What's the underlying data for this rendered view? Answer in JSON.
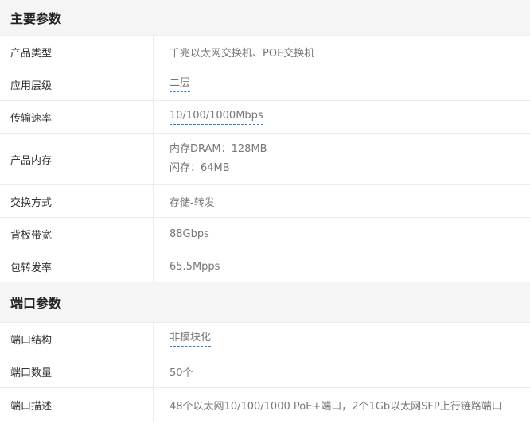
{
  "sections": [
    {
      "title": "主要参数",
      "rows": [
        {
          "label": "产品类型",
          "value": "千兆以太网交换机、POE交换机"
        },
        {
          "label": "应用层级",
          "value": "二层"
        },
        {
          "label": "传输速率",
          "value": "10/100/1000Mbps"
        },
        {
          "label": "产品内存",
          "lines": [
            "内存DRAM：128MB",
            "闪存：64MB"
          ]
        },
        {
          "label": "交换方式",
          "value": "存储-转发"
        },
        {
          "label": "背板带宽",
          "value": "88Gbps"
        },
        {
          "label": "包转发率",
          "value": "65.5Mpps"
        }
      ]
    },
    {
      "title": "端口参数",
      "rows": [
        {
          "label": "端口结构",
          "value": "非模块化"
        },
        {
          "label": "端口数量",
          "value": "50个"
        },
        {
          "label": "端口描述",
          "value": "48个以太网10/100/1000 PoE+端口，2个1Gb以太网SFP上行链路端口"
        }
      ]
    }
  ],
  "link_underline_color": "#2b7fd9"
}
